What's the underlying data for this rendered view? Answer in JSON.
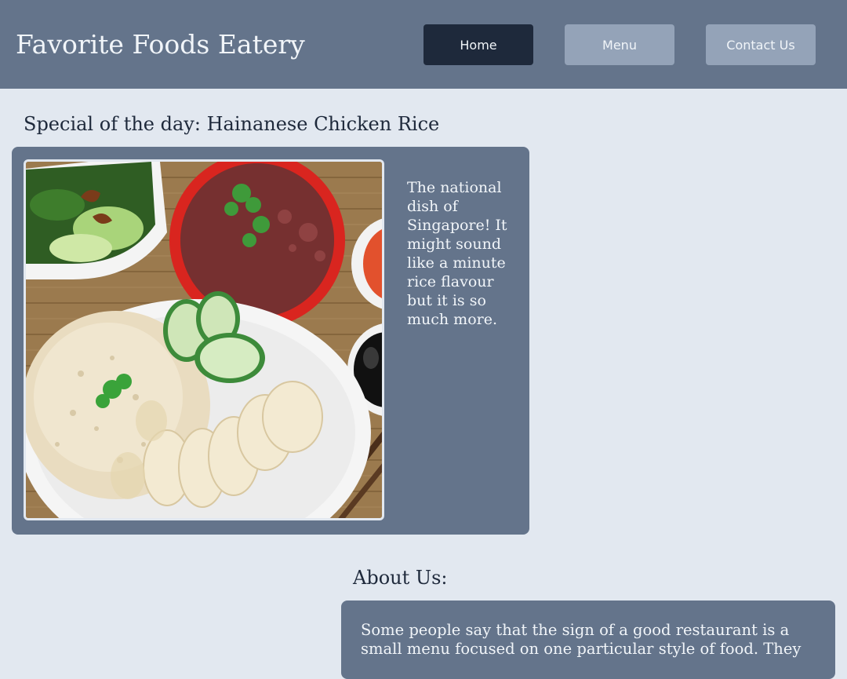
{
  "header": {
    "site_title": "Favorite Foods Eatery",
    "nav": {
      "home": "Home",
      "menu": "Menu",
      "contact": "Contact Us"
    }
  },
  "special": {
    "heading": "Special of the day: Hainanese Chicken Rice",
    "image_icon": "hainanese-chicken-rice-photo",
    "description": "The national dish of Singapore! It might sound like a minute rice flavour but it is so much more."
  },
  "about": {
    "heading": "About Us:",
    "text": "Some people say that the sign of a good restaurant is a small menu focused on one particular style of food. They"
  },
  "colors": {
    "page_bg": "#e2e8f0",
    "header_bg": "#64748b",
    "card_bg": "#64748b",
    "nav_active": "#1e293b",
    "nav_inactive": "#94a3b8"
  }
}
